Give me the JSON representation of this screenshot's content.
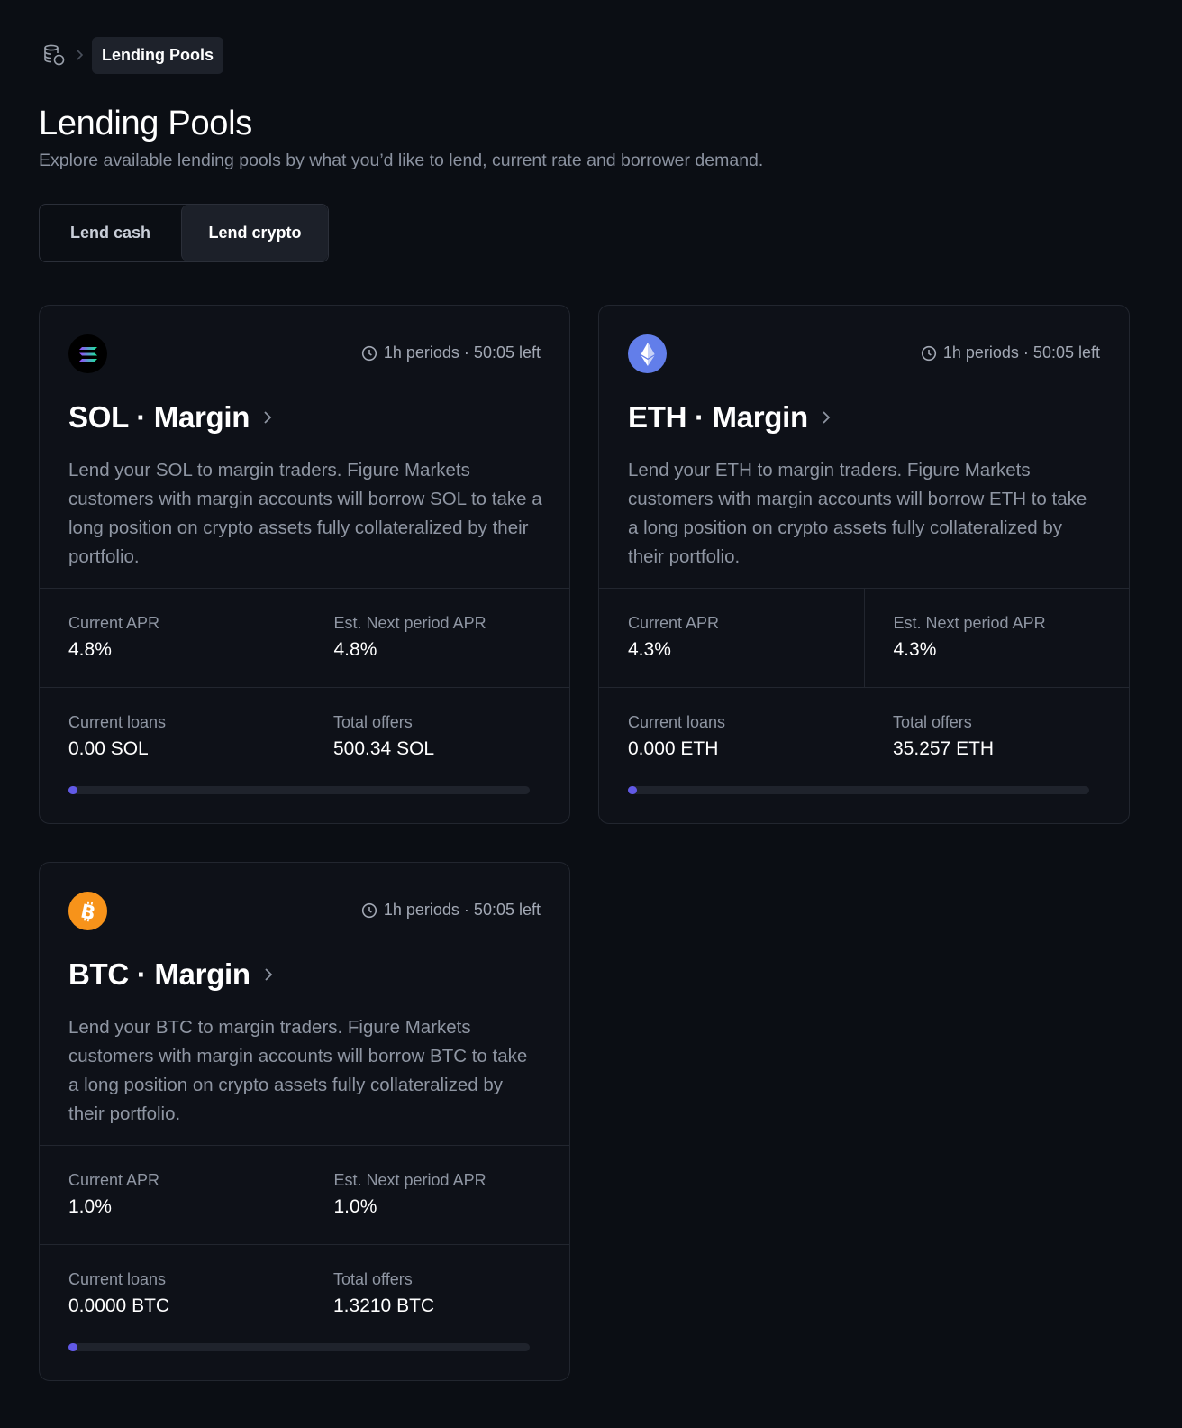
{
  "breadcrumb": {
    "current": "Lending Pools"
  },
  "page": {
    "title": "Lending Pools",
    "subtitle": "Explore available lending pools by what you’d like to lend, current rate and borrower demand."
  },
  "toggle": {
    "lend_cash": "Lend cash",
    "lend_crypto": "Lend crypto",
    "selected": "Lend crypto"
  },
  "pools": [
    {
      "asset": "SOL",
      "icon": "solana-icon",
      "period": "1h periods · 50:05 left",
      "title": "SOL · Margin",
      "description": "Lend your SOL to margin traders. Figure Markets customers with margin accounts will borrow SOL to take a long position on crypto assets fully collateralized by their portfolio.",
      "current_apr_label": "Current APR",
      "current_apr": "4.8%",
      "next_apr_label": "Est. Next period APR",
      "next_apr": "4.8%",
      "current_loans_label": "Current loans",
      "current_loans": "0.00 SOL",
      "total_offers_label": "Total offers",
      "total_offers": "500.34 SOL",
      "utilization": 0
    },
    {
      "asset": "ETH",
      "icon": "ethereum-icon",
      "period": "1h periods · 50:05 left",
      "title": "ETH · Margin",
      "description": "Lend your ETH to margin traders. Figure Markets customers with margin accounts will borrow ETH to take a long position on crypto assets fully collateralized by their portfolio.",
      "current_apr_label": "Current APR",
      "current_apr": "4.3%",
      "next_apr_label": "Est. Next period APR",
      "next_apr": "4.3%",
      "current_loans_label": "Current loans",
      "current_loans": "0.000 ETH",
      "total_offers_label": "Total offers",
      "total_offers": "35.257 ETH",
      "utilization": 0
    },
    {
      "asset": "BTC",
      "icon": "bitcoin-icon",
      "period": "1h periods · 50:05 left",
      "title": "BTC · Margin",
      "description": "Lend your BTC to margin traders. Figure Markets customers with margin accounts will borrow BTC to take a long position on crypto assets fully collateralized by their portfolio.",
      "current_apr_label": "Current APR",
      "current_apr": "1.0%",
      "next_apr_label": "Est. Next period APR",
      "next_apr": "1.0%",
      "current_loans_label": "Current loans",
      "current_loans": "0.0000 BTC",
      "total_offers_label": "Total offers",
      "total_offers": "1.3210 BTC",
      "utilization": 0
    }
  ],
  "colors": {
    "background": "#0b0e14",
    "card": "#0e1118",
    "accent": "#6159e6",
    "sol": "#000000",
    "eth": "#627eea",
    "btc": "#f7931a"
  }
}
